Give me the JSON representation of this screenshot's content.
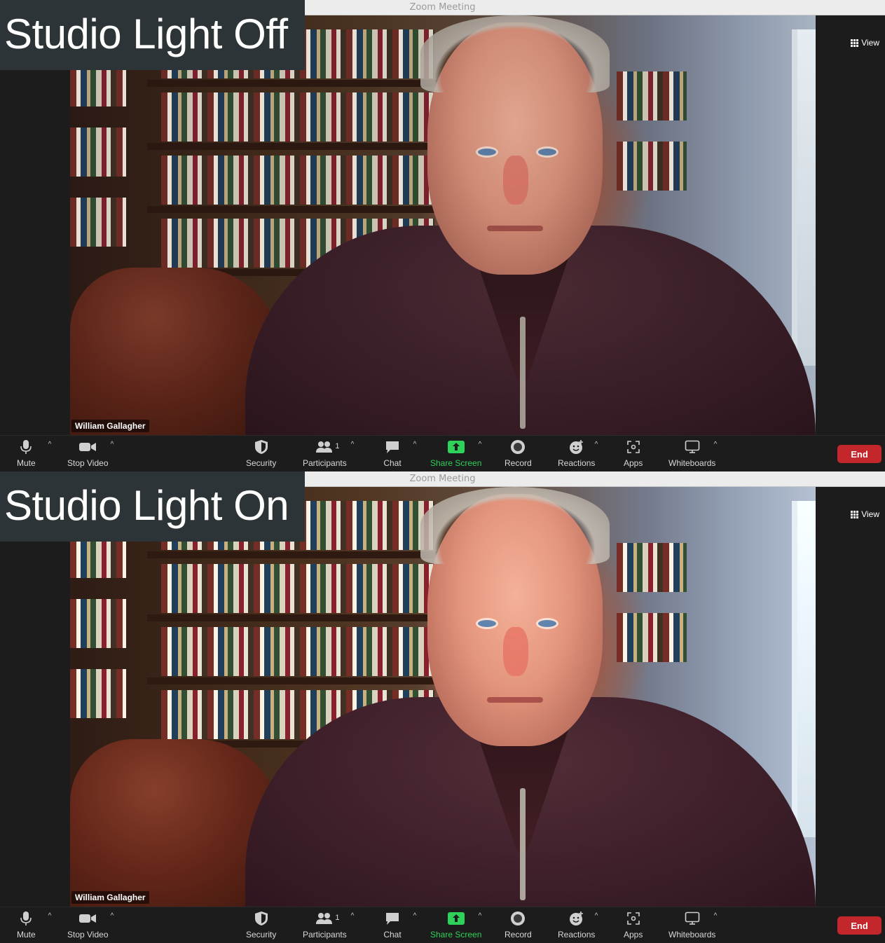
{
  "window": {
    "title": "Zoom Meeting"
  },
  "panels": [
    {
      "caption": "Studio Light Off",
      "participant_name": "William Gallagher"
    },
    {
      "caption": "Studio Light On",
      "participant_name": "William Gallagher"
    }
  ],
  "view_button": {
    "label": "View",
    "icon": "grid-icon"
  },
  "toolbar": {
    "mute": {
      "label": "Mute",
      "icon": "microphone-icon"
    },
    "stop_video": {
      "label": "Stop Video",
      "icon": "video-camera-icon"
    },
    "security": {
      "label": "Security",
      "icon": "shield-icon"
    },
    "participants": {
      "label": "Participants",
      "icon": "participants-icon",
      "count": "1"
    },
    "chat": {
      "label": "Chat",
      "icon": "chat-bubble-icon"
    },
    "share_screen": {
      "label": "Share Screen",
      "icon": "share-arrow-icon"
    },
    "record": {
      "label": "Record",
      "icon": "record-icon"
    },
    "reactions": {
      "label": "Reactions",
      "icon": "smiley-icon"
    },
    "apps": {
      "label": "Apps",
      "icon": "apps-icon"
    },
    "whiteboards": {
      "label": "Whiteboards",
      "icon": "whiteboard-icon"
    },
    "end": {
      "label": "End"
    }
  },
  "colors": {
    "accent_green": "#2ed15a",
    "end_red": "#c3272b",
    "toolbar_bg": "#1c1c1c",
    "caption_bg": "#2d3437"
  }
}
